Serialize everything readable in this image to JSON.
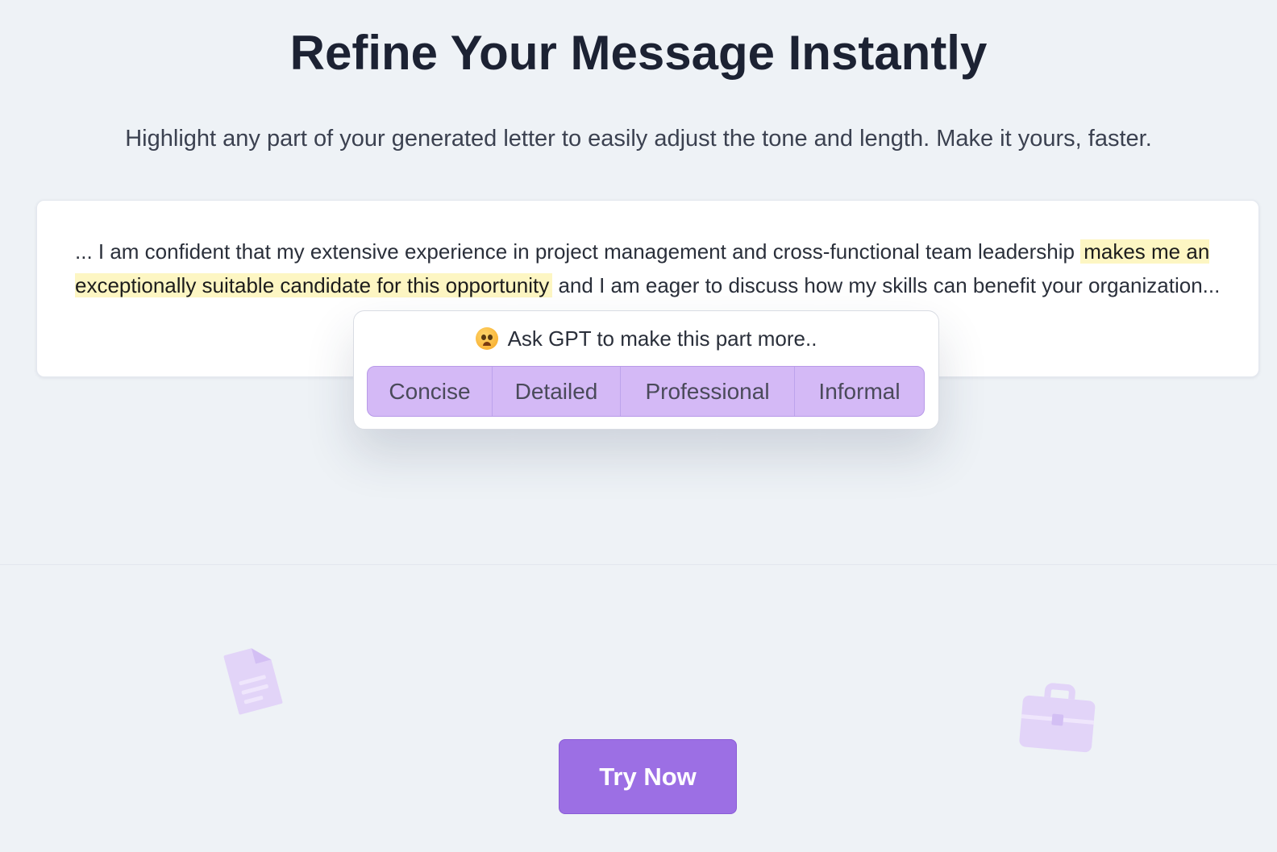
{
  "header": {
    "title": "Refine Your Message Instantly",
    "subtitle": "Highlight any part of your generated letter to easily adjust the tone and length. Make it yours, faster."
  },
  "letter": {
    "text_before": "... I am confident that my extensive experience in project management and cross-functional team leadership ",
    "highlighted": "makes me an exceptionally suitable candidate for this opportunity",
    "text_after": " and I am eager to discuss how my skills can benefit your organization..."
  },
  "popover": {
    "prompt": "Ask GPT to make this part more..",
    "emoji_icon": "worried-face-emoji",
    "options": [
      "Concise",
      "Detailed",
      "Professional",
      "Informal"
    ]
  },
  "cta": {
    "label": "Try Now"
  },
  "decorations": {
    "left_icon": "document-icon",
    "right_icon": "briefcase-icon",
    "color": "#e2d4f8"
  },
  "colors": {
    "accent": "#9c6fe4",
    "option_bg": "#d4b9f6",
    "highlight_bg": "#fdf6c3",
    "page_bg": "#eef2f6"
  }
}
